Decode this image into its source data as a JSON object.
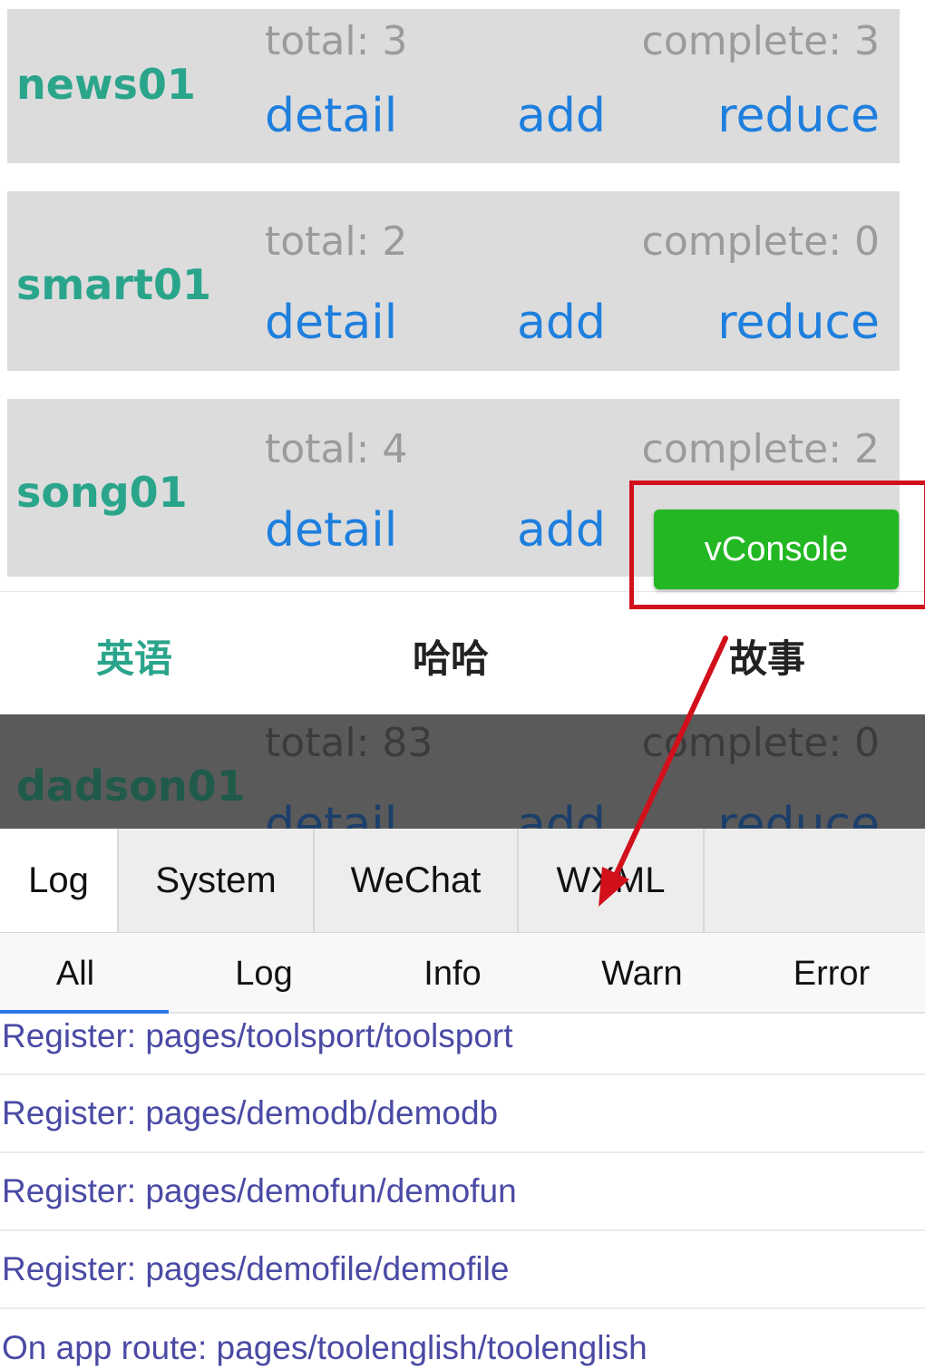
{
  "cards": [
    {
      "name": "news01",
      "total": "total: 3",
      "complete": "complete: 3",
      "detail": "detail",
      "add": "add",
      "reduce": "reduce"
    },
    {
      "name": "smart01",
      "total": "total: 2",
      "complete": "complete: 0",
      "detail": "detail",
      "add": "add",
      "reduce": "reduce"
    },
    {
      "name": "song01",
      "total": "total: 4",
      "complete": "complete: 2",
      "detail": "detail",
      "add": "add"
    }
  ],
  "vconsole_button": "vConsole",
  "category_tabs": {
    "active": "英语",
    "items": [
      "英语",
      "哈哈",
      "故事"
    ]
  },
  "dimmed_card": {
    "name": "dadson01",
    "total": "total: 83",
    "complete": "complete: 0",
    "detail": "detail",
    "add": "add",
    "reduce": "reduce"
  },
  "vconsole": {
    "tabs": [
      "Log",
      "System",
      "WeChat",
      "WXML"
    ],
    "active_tab": "Log",
    "subtabs": [
      "All",
      "Log",
      "Info",
      "Warn",
      "Error"
    ],
    "active_subtab": "All",
    "logs": [
      "Register: pages/toolsport/toolsport",
      "Register: pages/demodb/demodb",
      "Register: pages/demofun/demofun",
      "Register: pages/demofile/demofile",
      "On app route: pages/toolenglish/toolenglish"
    ]
  },
  "colors": {
    "accent_green": "#2aa58b",
    "link_blue": "#1e7fde",
    "vconsole_green": "#23b823",
    "annotation_red": "#d1101b"
  }
}
